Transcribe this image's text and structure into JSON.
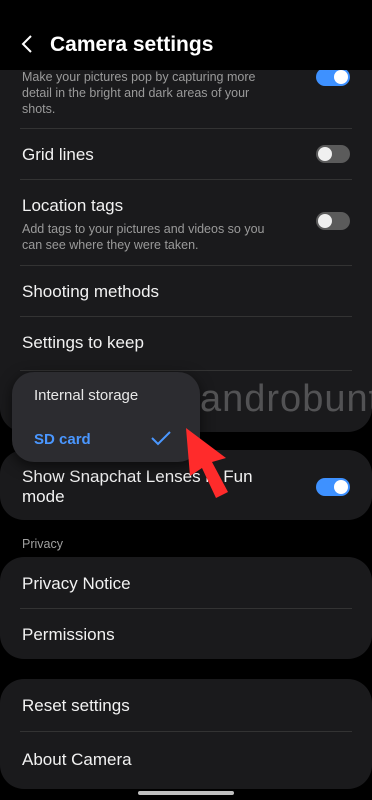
{
  "header": {
    "title": "Camera settings"
  },
  "top_card": {
    "partial_sub": "Make your pictures pop by capturing more detail in the bright and dark areas of your shots.",
    "grid_lines": "Grid lines",
    "location_tags": "Location tags",
    "location_tags_sub": "Add tags to your pictures and videos so you can see where they were taken.",
    "shooting_methods": "Shooting methods",
    "settings_to_keep": "Settings to keep",
    "toggles": {
      "partial": true,
      "grid_lines": false,
      "location_tags": false
    }
  },
  "popup": {
    "options": [
      "Internal storage",
      "SD card"
    ],
    "selected": "SD card"
  },
  "snapchat": {
    "label": "Show Snapchat Lenses in Fun mode",
    "enabled": true
  },
  "privacy": {
    "section": "Privacy",
    "notice": "Privacy Notice",
    "permissions": "Permissions"
  },
  "bottom": {
    "reset": "Reset settings",
    "about": "About Camera"
  },
  "watermark": "androbuntu",
  "colors": {
    "accent": "#3e91ff",
    "arrow": "#ff2b2b"
  }
}
